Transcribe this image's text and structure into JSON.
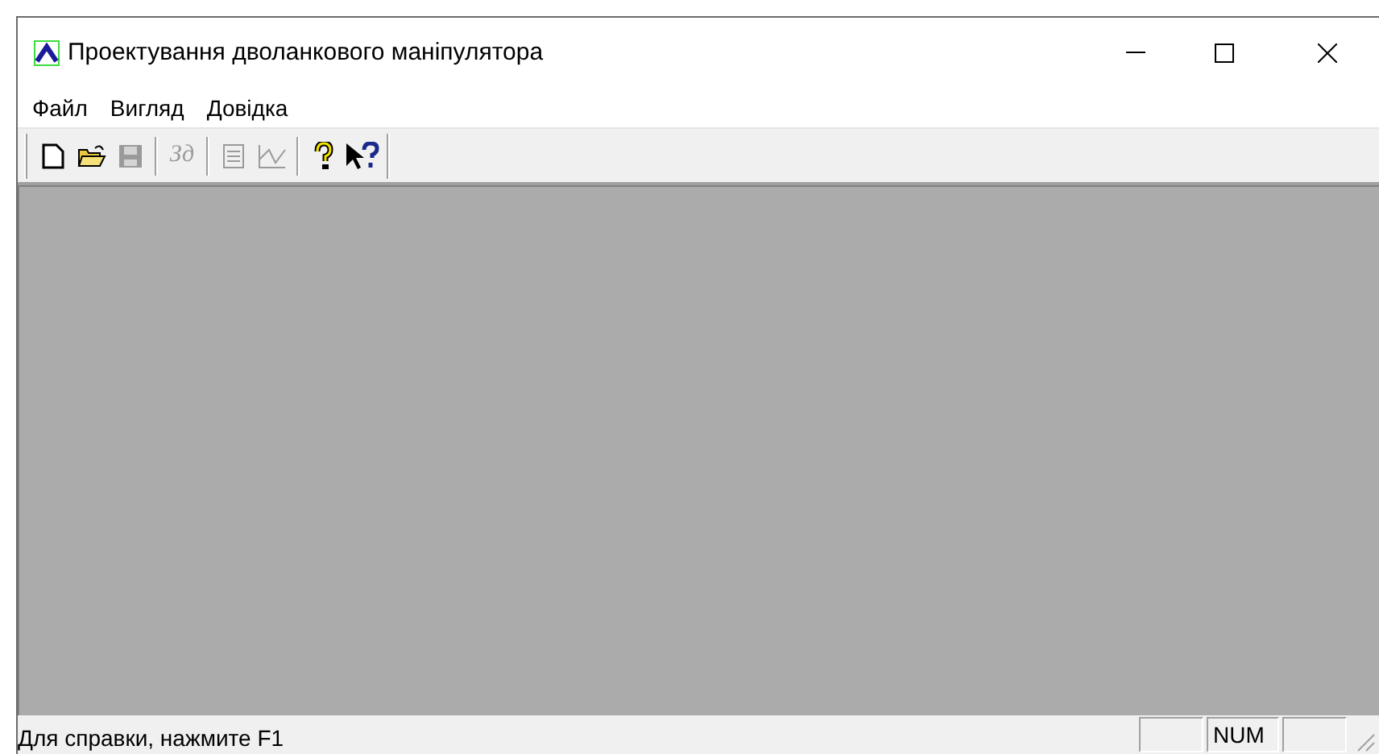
{
  "window": {
    "title": "Проектування дволанкового маніпулятора"
  },
  "menu": [
    "Файл",
    "Вигляд",
    "Довідка"
  ],
  "toolbar": [
    {
      "kind": "new",
      "disabled": false
    },
    {
      "kind": "open",
      "disabled": false
    },
    {
      "kind": "save",
      "disabled": true
    },
    {
      "kind": "sep"
    },
    {
      "kind": "text",
      "label": "Зд",
      "disabled": true
    },
    {
      "kind": "sep"
    },
    {
      "kind": "list",
      "disabled": true
    },
    {
      "kind": "chart",
      "disabled": true
    },
    {
      "kind": "sep"
    },
    {
      "kind": "help",
      "disabled": false
    },
    {
      "kind": "context-help",
      "disabled": false
    }
  ],
  "status_bar": {
    "message": "Для справки, нажмите F1",
    "panes": [
      {
        "kind": "blank"
      },
      {
        "kind": "indicator",
        "text": "NUM"
      },
      {
        "kind": "blank"
      }
    ]
  }
}
